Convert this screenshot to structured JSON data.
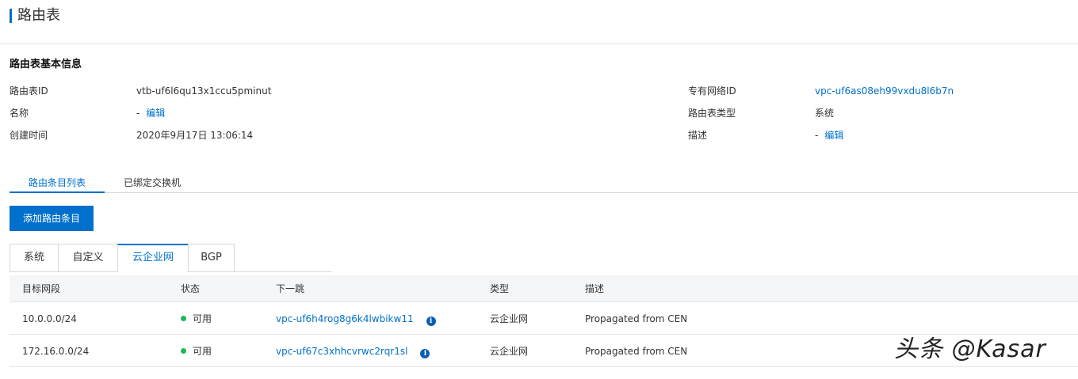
{
  "page": {
    "title": "路由表"
  },
  "basic_info": {
    "title": "路由表基本信息",
    "left": [
      {
        "label": "路由表ID",
        "value": "vtb-uf6l6qu13x1ccu5pminut"
      },
      {
        "label": "名称",
        "value": "-",
        "edit": "编辑"
      },
      {
        "label": "创建时间",
        "value": "2020年9月17日 13:06:14"
      }
    ],
    "right": [
      {
        "label": "专有网络ID",
        "value": "vpc-uf6as08eh99vxdu8l6b7n"
      },
      {
        "label": "路由表类型",
        "value": "系统"
      },
      {
        "label": "描述",
        "value": "-",
        "edit": "编辑"
      }
    ]
  },
  "tabs": [
    {
      "label": "路由条目列表",
      "active": true
    },
    {
      "label": "已绑定交换机",
      "active": false
    }
  ],
  "add_button": {
    "label": "添加路由条目"
  },
  "subtabs": [
    {
      "label": "系统",
      "active": false
    },
    {
      "label": "自定义",
      "active": false
    },
    {
      "label": "云企业网",
      "active": true
    },
    {
      "label": "BGP",
      "active": false
    }
  ],
  "table": {
    "headers": [
      "目标网段",
      "状态",
      "下一跳",
      "类型",
      "描述"
    ],
    "rows": [
      {
        "cidr": "10.0.0.0/24",
        "status": "可用",
        "next_hop": "vpc-uf6h4rog8g6k4lwbikw11",
        "type": "云企业网",
        "desc": "Propagated from CEN"
      },
      {
        "cidr": "172.16.0.0/24",
        "status": "可用",
        "next_hop": "vpc-uf67c3xhhcvrwc2rqr1sl",
        "type": "云企业网",
        "desc": "Propagated from CEN"
      }
    ]
  },
  "watermark": "头条 @Kasar",
  "colors": {
    "accent": "#0070cc",
    "status_ok": "#1fb85a",
    "header_bg": "#f5f6f8"
  }
}
